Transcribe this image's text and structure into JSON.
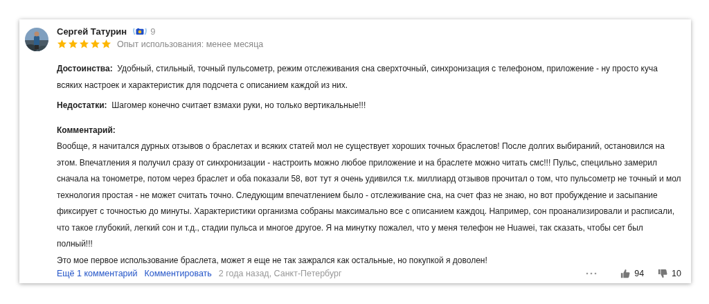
{
  "review": {
    "author": "Сергей Татурин",
    "badge_count": "9",
    "stars": 5,
    "experience": "Опыт использования: менее месяца",
    "pros": {
      "label": "Достоинства:",
      "text": "Удобный, стильный, точный пульсометр, режим отслеживания сна сверхточный, синхронизация с телефоном, приложение - ну просто куча всяких настроек и характеристик для подсчета с описанием каждой из них."
    },
    "cons": {
      "label": "Недостатки:",
      "text": "Шагомер конечно считает взмахи руки, но только вертикальные!!!"
    },
    "comment": {
      "label": "Комментарий:",
      "paragraphs": [
        "Вообще, я начитался дурных отзывов о браслетах и всяких статей мол не существует хороших точных браслетов! После долгих выбираний, остановился на этом. Впечатления я получил сразу от синхронизации - настроить можно любое приложение и на браслете можно читать смс!!! Пульс, специльно замерил сначала на тонометре, потом через браслет и оба показали 58, вот тут я очень удивился т.к. миллиард отзывов прочитал о том, что пульсометр не точный и мол технология простая - не может считать точно. Следующим впечатлением было - отслеживание сна, на счет фаз не знаю, но вот пробуждение и засыпание фиксирует с точностью до минуты. Характеристики организма собраны максимально все с описанием каждоц. Например, сон проанализировали и расписали, что такое глубокий, легкий сон и т.д., стадии пульса и многое другое. Я на минутку пожалел, что у меня телефон не Huawei, так сказать, чтобы сет был полный!!!",
        "Это мое первое использование браслета, может я еще не так зажрался как остальные, но покупкой я доволен!"
      ]
    },
    "footer": {
      "more_comments": "Ещё 1 комментарий",
      "comment_link": "Комментировать",
      "meta": "2 года назад, Санкт-Петербург",
      "likes": "94",
      "dislikes": "10"
    }
  }
}
